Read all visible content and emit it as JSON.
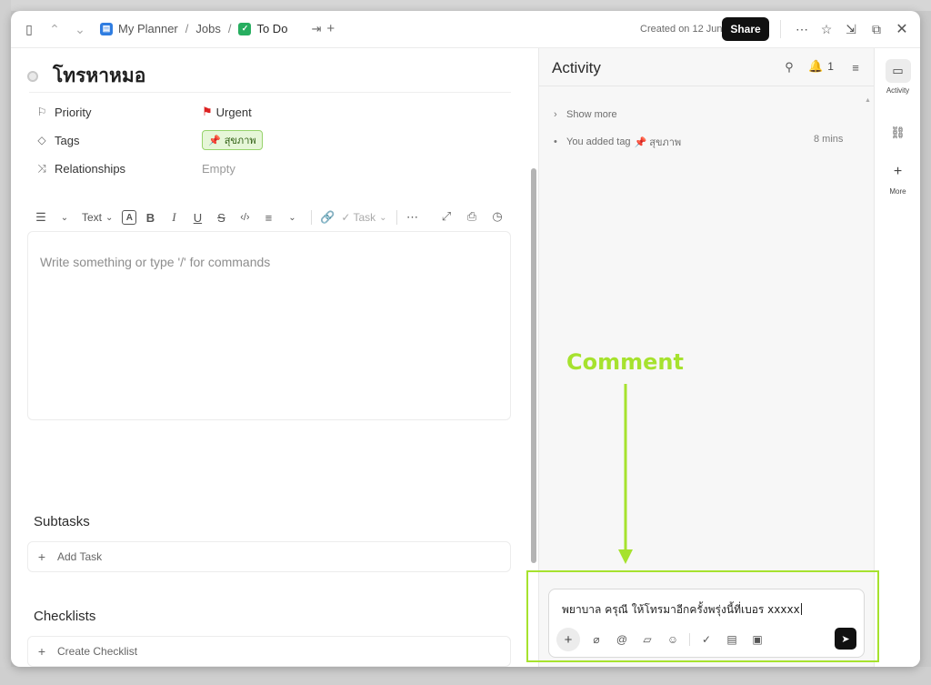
{
  "topbar": {
    "breadcrumbs": [
      {
        "label": "My Planner",
        "badge_color": "#2f7de1"
      },
      {
        "label": "Jobs"
      },
      {
        "label": "To Do",
        "badge_color": "#27ae60"
      }
    ],
    "created": "Created on 12 Jun",
    "share_label": "Share"
  },
  "task": {
    "title": "โทรหาหมอ",
    "properties": [
      {
        "icon": "flag-outline-icon",
        "label": "Priority",
        "value": "Urgent",
        "value_color": "#dd2222"
      },
      {
        "icon": "tag-icon",
        "label": "Tags",
        "value": "สุขภาพ",
        "chip_color": "#97d36c"
      },
      {
        "icon": "relationship-icon",
        "label": "Relationships",
        "value": "Empty"
      }
    ]
  },
  "editor": {
    "text_style": "Text",
    "task_label": "Task",
    "placeholder": "Write something or type '/' for commands"
  },
  "subtasks": {
    "title": "Subtasks",
    "add_label": "Add Task"
  },
  "checklists": {
    "title": "Checklists",
    "add_label": "Create Checklist"
  },
  "activity": {
    "title": "Activity",
    "notification_count": "1",
    "show_more": "Show more",
    "events": [
      {
        "text": "You added tag",
        "tag": "สุขภาพ",
        "time": "8 mins"
      }
    ],
    "comment_text": "พยาบาล ครุณี ให้โทรมาอีกครั้งพรุ่งนี้ที่เบอร  xxxxx"
  },
  "rail": [
    {
      "icon": "comment-icon",
      "label": "Activity",
      "active": true
    },
    {
      "icon": "link-icon",
      "label": ""
    },
    {
      "icon": "plus-icon",
      "label": "More"
    }
  ],
  "annotation": {
    "label": "Comment",
    "color": "#a6e22e"
  }
}
